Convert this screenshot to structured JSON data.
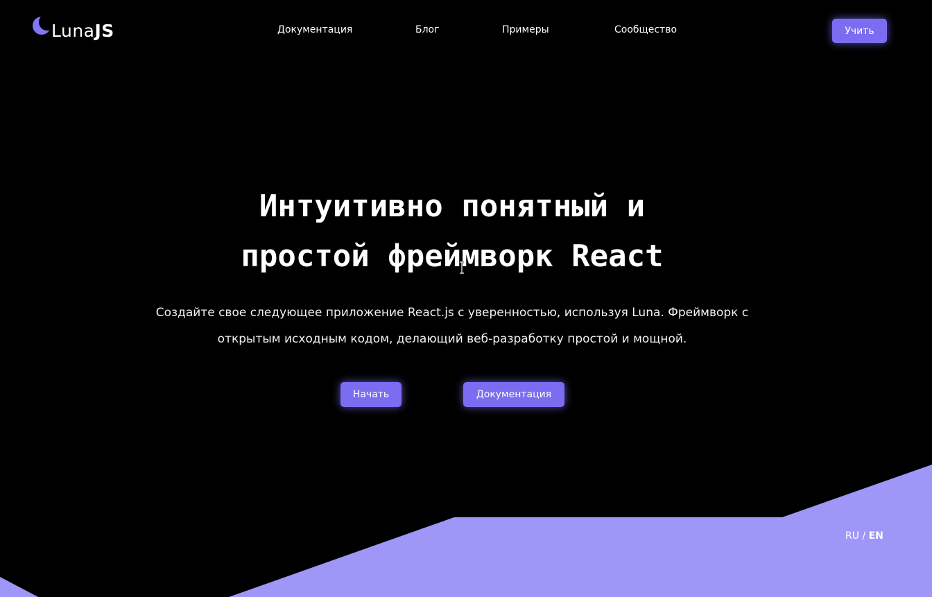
{
  "logo": {
    "text_light": "Luna",
    "text_bold": "JS",
    "icon": "crescent-moon-icon",
    "moon_color": "#8176f4"
  },
  "nav": {
    "items": [
      {
        "label": "Документация"
      },
      {
        "label": "Блог"
      },
      {
        "label": "Примеры"
      },
      {
        "label": "Сообщество"
      }
    ],
    "cta_label": "Учить"
  },
  "hero": {
    "title_line1": "Интуитивно понятный и",
    "title_line2": "простой фреймворк React",
    "subtitle_line1": "Создайте свое следующее приложение React.js с уверенностью, используя Luna. Фреймворк с",
    "subtitle_line2": "открытым исходным кодом, делающий веб-разработку простой и мощной.",
    "primary_button": "Начать",
    "secondary_button": "Документация"
  },
  "language": {
    "ru": "RU",
    "separator": "/",
    "en": "EN",
    "active": "EN"
  },
  "colors": {
    "background": "#000000",
    "accent": "#7b6cf2",
    "wave": "#9f97f7",
    "text": "#ffffff"
  }
}
